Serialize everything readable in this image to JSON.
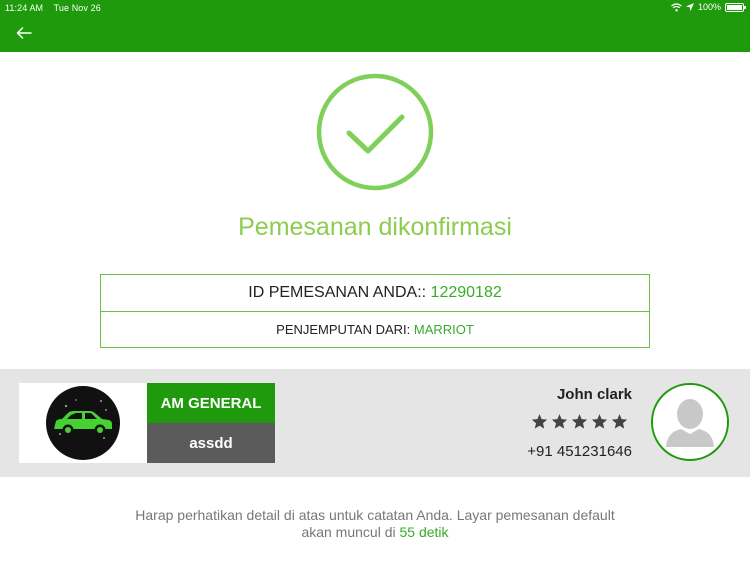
{
  "status_bar": {
    "time": "11:24 AM",
    "date": "Tue Nov 26",
    "battery": "100%"
  },
  "colors": {
    "header": "#1e9a0c",
    "accent_green": "#3aaa2b",
    "title_green": "#8ccc4f",
    "panel_gray": "#e5e5e5",
    "plate_gray": "#5b5b5b"
  },
  "header": {
    "back_icon": "back-arrow-icon"
  },
  "confirmation": {
    "icon": "check-circle-icon",
    "title": "Pemesanan dikonfirmasi",
    "booking_id_label": "ID PEMESANAN ANDA::",
    "booking_id_value": "12290182",
    "pickup_label": "PENJEMPUTAN DARI:",
    "pickup_value": "MARRIOT"
  },
  "driver": {
    "car_brand": "AM GENERAL",
    "car_plate": "assdd",
    "name": "John clark",
    "rating": 5,
    "rating_max": 5,
    "phone": "+91 451231646",
    "avatar_icon": "person-avatar-icon",
    "car_icon": "car-logo-icon"
  },
  "footer_note": {
    "line1": "Harap perhatikan detail di atas untuk catatan Anda. Layar pemesanan default",
    "line2_prefix": "akan muncul di",
    "countdown": "55 detik"
  }
}
